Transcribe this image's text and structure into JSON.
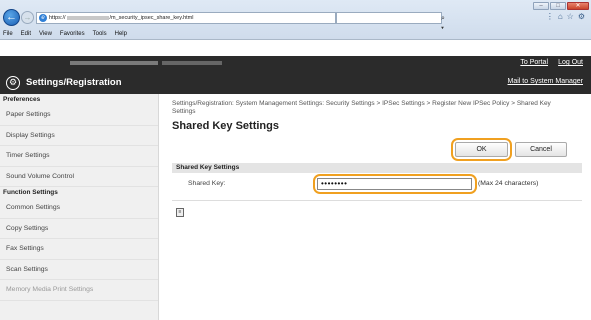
{
  "browser": {
    "url_prefix": "https://",
    "url_suffix": "/m_security_ipsec_share_key.html",
    "search_placeholder": "⌕ ▾",
    "win_min": "–",
    "win_max": "□",
    "win_close": "✕",
    "tools": [
      "⋮",
      "⌂",
      "☆",
      "⚙"
    ],
    "menu": [
      "File",
      "Edit",
      "View",
      "Favorites",
      "Tools",
      "Help"
    ]
  },
  "header": {
    "to_portal": "To Portal",
    "log_out": "Log Out",
    "title": "Settings/Registration",
    "mail_to": "Mail to System Manager"
  },
  "sidebar": {
    "sections": [
      {
        "heading": "Preferences",
        "items": [
          "Paper Settings",
          "Display Settings",
          "Timer Settings",
          "Sound Volume Control"
        ]
      },
      {
        "heading": "Function Settings",
        "items": [
          "Common Settings",
          "Copy Settings",
          "Fax Settings",
          "Scan Settings",
          "Memory Media Print Settings"
        ]
      }
    ]
  },
  "main": {
    "breadcrumb": "Settings/Registration: System Management Settings: Security Settings > IPSec Settings > Register New IPSec Policy > Shared Key Settings",
    "title": "Shared Key Settings",
    "ok_label": "OK",
    "cancel_label": "Cancel",
    "section_heading": "Shared Key Settings",
    "shared_key_label": "Shared Key:",
    "shared_key_value": "••••••••",
    "hint": "(Max 24 characters)",
    "doc_icon_glyph": "≡"
  },
  "colors": {
    "highlight": "#f0a020",
    "header_bg": "#2b2b2b"
  }
}
